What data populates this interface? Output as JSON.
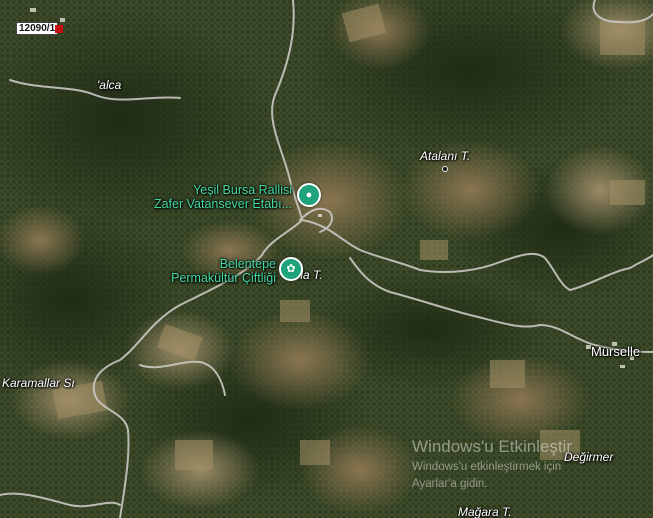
{
  "map": {
    "map_type": "satellite",
    "scale_chip": "12090/1",
    "place_labels": {
      "alca": "'alca",
      "atalani": "Atalanı T.",
      "yala": "/la T.",
      "karamallar": "Karamallar Sı",
      "murseller": "Mürselle",
      "degirmer": "Değirmer",
      "magara": "Mağara T."
    },
    "pois": [
      {
        "name_line1": "Yeşil Bursa Rallisi",
        "name_line2": "Zafer Vatansever Etabı...",
        "icon": "location-circle-icon",
        "color": "#1fa37a"
      },
      {
        "name_line1": "Belentepe",
        "name_line2": "Permakültür Çiftliği",
        "icon": "flower-icon",
        "color": "#1fa37a"
      }
    ],
    "watermark": {
      "title": "Windows'u Etkinleştir",
      "line1": "Windows'u etkinleştirmek için",
      "line2": "Ayarlar'a gidin."
    }
  }
}
